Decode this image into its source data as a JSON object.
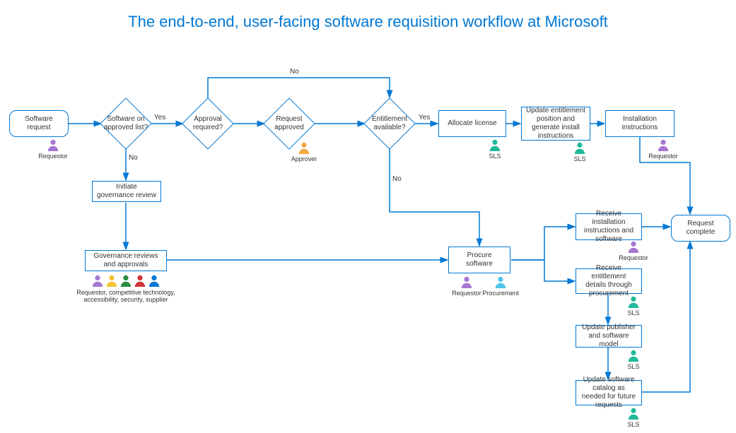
{
  "title": "The end-to-end, user-facing software requisition workflow at Microsoft",
  "nodes": {
    "softwareRequest": "Software request",
    "approvedList": "Software on approved list?",
    "approvalRequired": "Approval required?",
    "requestApproved": "Request approved",
    "entitlementAvailable": "Entitlement available?",
    "allocateLicense": "Allocate license",
    "updateEntitlement": "Update entitlement position and generate install instructions",
    "installInstructions": "Installation instructions",
    "initiateGovernance": "Initiate governance review",
    "governanceReviews": "Governance reviews and approvals",
    "procureSoftware": "Procure software",
    "receiveInstall": "Receive installation instructions and software",
    "receiveEntitlement": "Receive entitlement details through procurement",
    "updatePublisher": "Update publisher and software model",
    "updateCatalog": "Update software catalog as needed for future requests",
    "requestComplete": "Request complete"
  },
  "edgeLabels": {
    "yes": "Yes",
    "no": "No"
  },
  "actors": {
    "requestor": "Requestor",
    "approver": "Approver",
    "sls": "SLS",
    "procurement": "Procurement",
    "governanceGroup": "Requestor, competitive technology, accessibility, security, supplier"
  },
  "colors": {
    "line": "#0078d4",
    "requestor": "#a477d1",
    "approver": "#f5a742",
    "sls": "#1fb99a",
    "procurement": "#4fc3e8",
    "group": [
      "#a477d1",
      "#f4c430",
      "#2a8a3e",
      "#d13438",
      "#0078d4"
    ]
  }
}
